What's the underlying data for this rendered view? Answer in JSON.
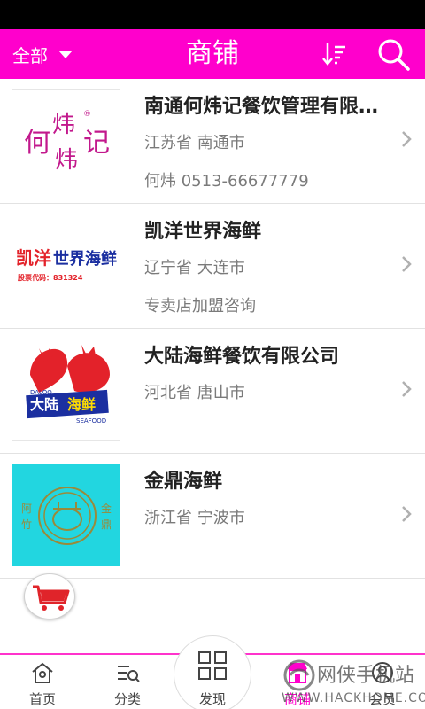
{
  "header": {
    "filter_label": "全部",
    "title": "商铺",
    "background": "#ff00cc"
  },
  "shops": [
    {
      "name": "南通何炜记餐饮管理有限公司",
      "region": "江苏省 南通市",
      "extra": "何炜 0513-66677779",
      "logo": "hewei-logo",
      "logo_text": "何 炜 记"
    },
    {
      "name": "凯洋世界海鲜",
      "region": "辽宁省 大连市",
      "extra": "专卖店加盟咨询",
      "logo": "kaiyang-logo",
      "logo_text": "凯洋世界海鲜",
      "logo_subtext": "股票代码：831324"
    },
    {
      "name": "大陆海鲜餐饮有限公司",
      "region": "河北省 唐山市",
      "extra": "",
      "logo": "dalu-logo",
      "logo_text": "大陆海鲜",
      "logo_subtext": "DALOO",
      "logo_subtext2": "SEAFOOD"
    },
    {
      "name": "金鼎海鲜",
      "region": "浙江省 宁波市",
      "extra": "",
      "logo": "jinding-logo",
      "logo_text_left": "阿竹",
      "logo_text_right": "金鼎"
    }
  ],
  "cart": {
    "icon": "cart-icon"
  },
  "tabs": [
    {
      "label": "首页",
      "icon": "home-icon",
      "active": false
    },
    {
      "label": "分类",
      "icon": "category-icon",
      "active": false
    },
    {
      "label": "发现",
      "icon": "discover-grid-icon",
      "active": false
    },
    {
      "label": "商铺",
      "icon": "shop-icon",
      "active": true
    },
    {
      "label": "会员",
      "icon": "member-icon",
      "active": false
    }
  ],
  "watermark": {
    "text": "网侠手机站",
    "url": "WWW.HACKHOME.COM"
  },
  "colors": {
    "accent": "#ff00cc",
    "muted_text": "#7a7a7a",
    "cart_red": "#e0242a"
  }
}
